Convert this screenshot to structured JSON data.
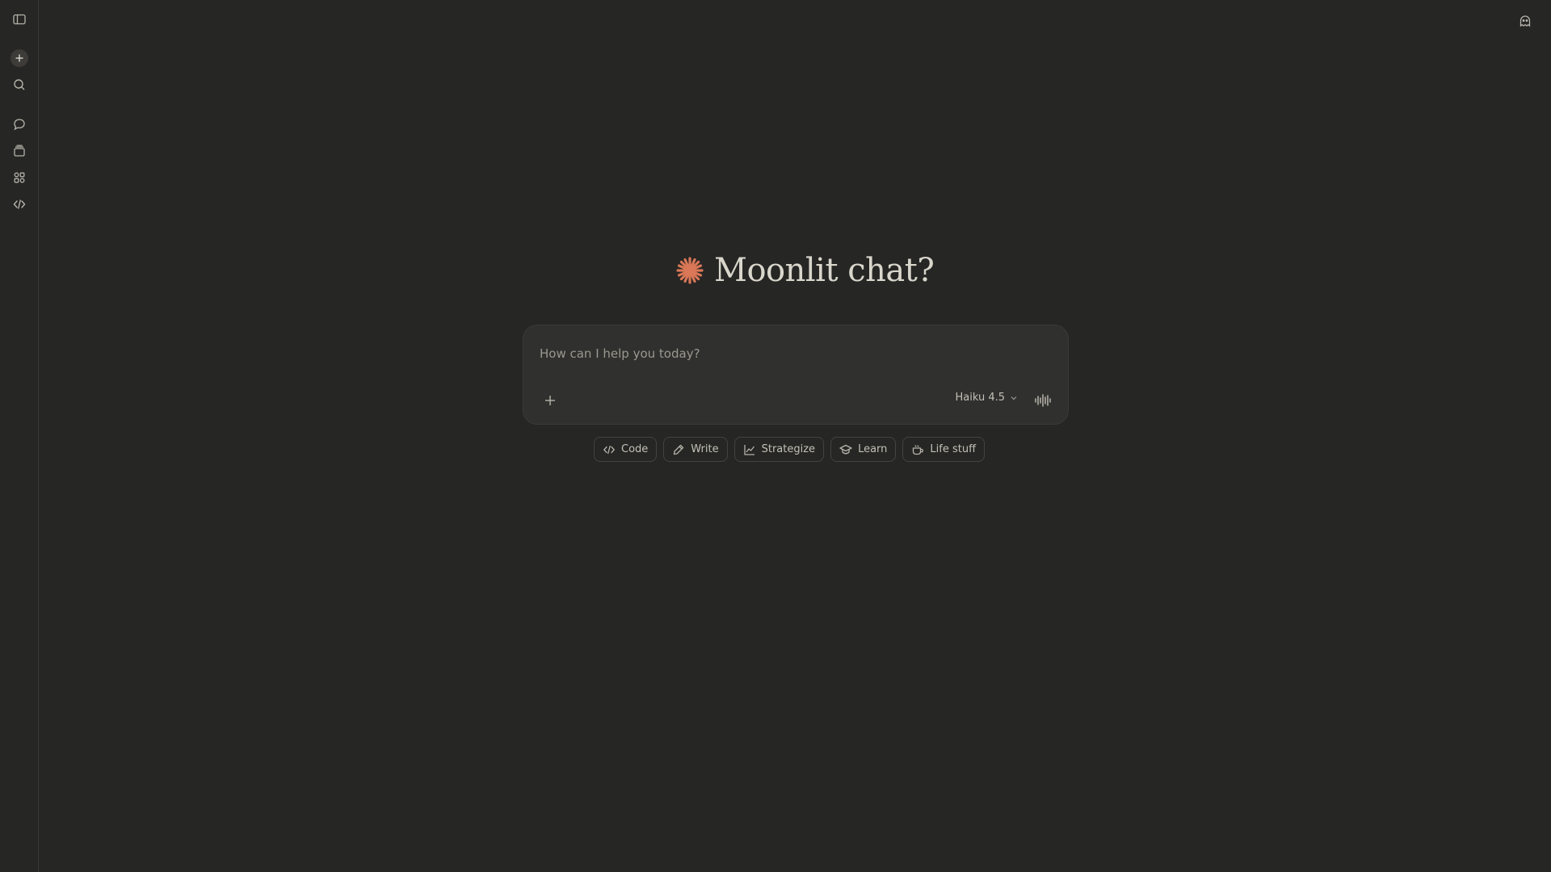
{
  "hero": {
    "title": "Moonlit chat?"
  },
  "composer": {
    "placeholder": "How can I help you today?",
    "model": "Haiku 4.5"
  },
  "chips": [
    {
      "label": "Code",
      "icon": "code-icon"
    },
    {
      "label": "Write",
      "icon": "pencil-icon"
    },
    {
      "label": "Strategize",
      "icon": "chart-line-icon"
    },
    {
      "label": "Learn",
      "icon": "graduation-cap-icon"
    },
    {
      "label": "Life stuff",
      "icon": "coffee-cup-icon"
    }
  ],
  "colors": {
    "accent": "#d97757",
    "background": "#262624",
    "surface": "#30302e",
    "text": "#c2c0b6"
  }
}
